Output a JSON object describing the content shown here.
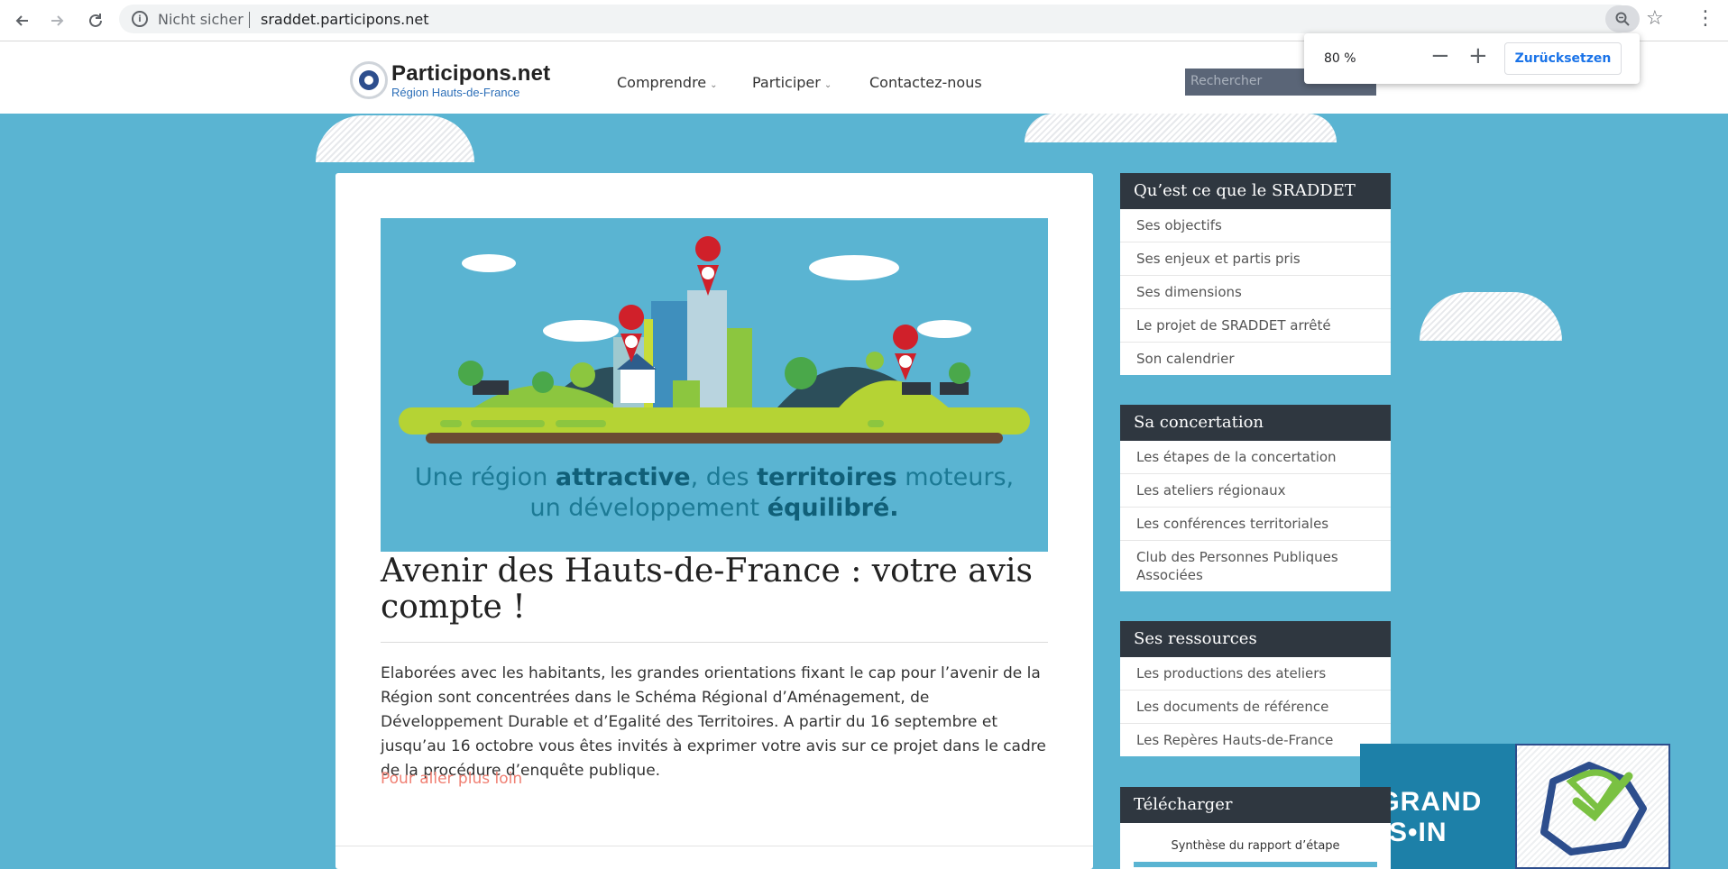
{
  "browser": {
    "security_label": "Nicht sicher",
    "url": "sraddet.participons.net",
    "zoom": {
      "value": "80 %",
      "minus": "−",
      "plus": "+",
      "reset_label": "Zurücksetzen"
    }
  },
  "site": {
    "logo_name": "Participons.net",
    "logo_sub": "Région Hauts-de-France",
    "nav": [
      {
        "label": "Comprendre"
      },
      {
        "label": "Participer"
      },
      {
        "label": "Contactez-nous"
      }
    ],
    "search_placeholder": "Rechercher"
  },
  "hero": {
    "line1_pre": "Une région ",
    "line1_b1": "attractive",
    "line1_mid": ", des ",
    "line1_b2": "territoires",
    "line1_post": " moteurs,",
    "line2_pre": "un développement ",
    "line2_b": "équilibré."
  },
  "article": {
    "title": "Avenir des Hauts-de-France : votre avis compte !",
    "body": "Elaborées avec les habitants, les grandes orientations fixant le cap pour l’avenir de la Région sont concentrées dans le Schéma Régional d’Aménagement, de Développement Durable et d’Egalité des Territoires. A partir du 16 septembre et jusqu’au 16 octobre vous êtes invités à exprimer votre avis sur ce projet dans le cadre de la procédure d’enquête publique.",
    "read_more": "Pour aller plus loin"
  },
  "sidebar": {
    "sraddet": {
      "title": "Qu’est ce que le SRADDET",
      "items": [
        "Ses objectifs",
        "Ses enjeux et partis pris",
        "Ses dimensions",
        "Le projet de SRADDET arrêté",
        "Son calendrier"
      ]
    },
    "concertation": {
      "title": "Sa concertation",
      "items": [
        "Les étapes de la concertation",
        "Les ateliers régionaux",
        "Les conférences territoriales",
        "Club des Personnes Publiques Associées"
      ]
    },
    "ressources": {
      "title": "Ses ressources",
      "items": [
        "Les productions des ateliers",
        "Les documents de référence",
        "Les Repères Hauts-de-France"
      ]
    },
    "telecharger": {
      "title": "Télécharger",
      "items": [
        "Synthèse du rapport d’étape"
      ]
    }
  },
  "grand_dessein": {
    "line1": "E GRAND",
    "line2": "ESS•IN"
  },
  "colors": {
    "background": "#5ab4d2",
    "widget_title_bg": "#2f3740",
    "link_accent": "#f07f72",
    "zoom_reset_text": "#1a73e8"
  }
}
